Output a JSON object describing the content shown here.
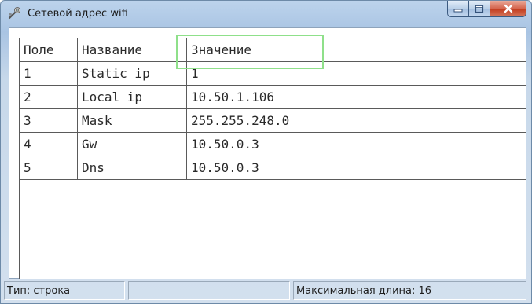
{
  "window": {
    "title": "Сетевой адрес wifi",
    "icon": "network-wand-icon"
  },
  "table": {
    "columns": [
      "Поле",
      "Название",
      "Значение"
    ],
    "rows": [
      {
        "field": "1",
        "name": "Static ip",
        "value": "1"
      },
      {
        "field": "2",
        "name": "Local ip",
        "value": "10.50.1.106"
      },
      {
        "field": "3",
        "name": "Mask",
        "value": "255.255.248.0"
      },
      {
        "field": "4",
        "name": "Gw",
        "value": "10.50.0.3"
      },
      {
        "field": "5",
        "name": "Dns",
        "value": "10.50.0.3"
      }
    ]
  },
  "status": {
    "type": "Тип: строка",
    "middle": "",
    "maxlen": "Максимальная длина: 16"
  },
  "colors": {
    "selection_border": "#8fe08a",
    "close_button": "#c2391c"
  }
}
